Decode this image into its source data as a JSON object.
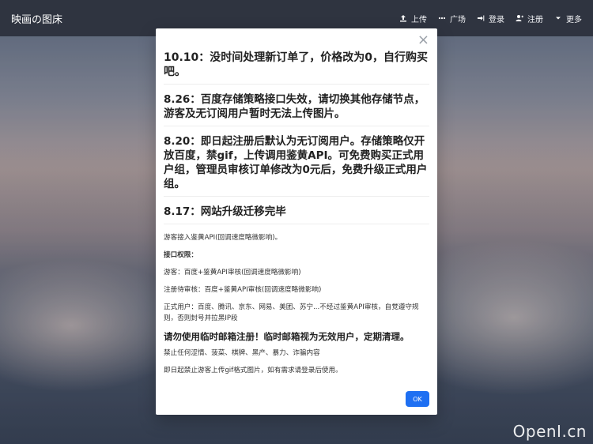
{
  "topbar": {
    "brand": "映画の图床",
    "nav": [
      {
        "icon": "upload-icon",
        "label": "上传"
      },
      {
        "icon": "dots-icon",
        "label": "广场"
      },
      {
        "icon": "login-icon",
        "label": "登录"
      },
      {
        "icon": "user-plus-icon",
        "label": "注册"
      },
      {
        "icon": "caret-down-icon",
        "label": "更多"
      }
    ]
  },
  "modal": {
    "close_symbol": "×",
    "notices": [
      {
        "title": "10.10：没时间处理新订单了，价格改为0，自行购买吧。"
      },
      {
        "title": "8.26：百度存储策略接口失效，请切换其他存储节点，游客及无订阅用户暂时无法上传图片。"
      },
      {
        "title": "8.20：即日起注册后默认为无订阅用户。存储策略仅开放百度，禁gif，上传调用鉴黄API。可免费购买正式用户组，管理员审核订单修改为0元后，免费升级正式用户组。"
      },
      {
        "title": "8.17：网站升级迁移完毕"
      }
    ],
    "paragraphs": [
      {
        "text": "游客接入鉴黄API(回调速度略微影响)。"
      },
      {
        "text": "接口权限："
      },
      {
        "text": "游客：百度+鉴黄API审核(回调速度略微影响)"
      },
      {
        "text": "注册待审核：百度+鉴黄API审核(回调速度略微影响)"
      },
      {
        "text": "正式用户：百度、腾讯、京东、网易、美团、苏宁...不经过鉴黄API审核，自觉遵守规则，否则封号并拉黑IP段"
      }
    ],
    "warning": "请勿使用临时邮箱注册！临时邮箱视为无效用户，定期清理。",
    "footer_paragraphs": [
      {
        "text": "禁止任何涩情、菠菜、棋牌、黑产、暴力、诈骗内容"
      },
      {
        "text": "即日起禁止游客上传gif格式图片，如有需求请登录后使用。"
      }
    ],
    "ok_label": "OK"
  },
  "watermark": "OpenI.cn"
}
